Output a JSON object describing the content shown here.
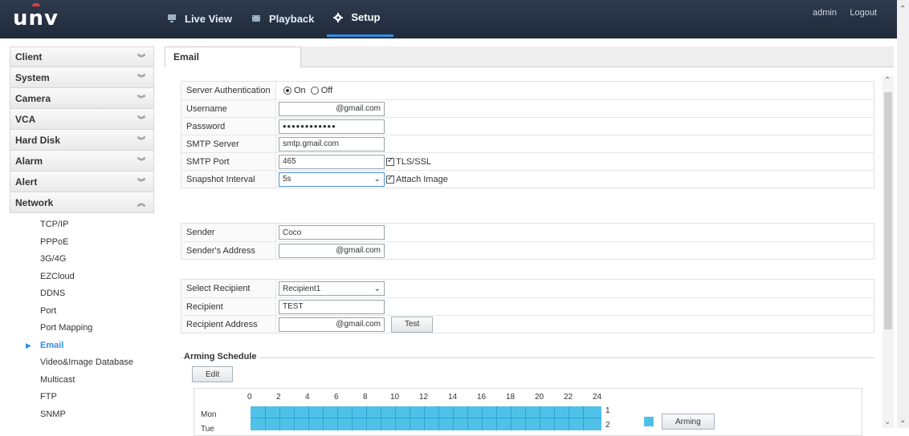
{
  "header": {
    "logo": "unv",
    "nav": [
      {
        "label": "Live View",
        "icon": "monitor-icon"
      },
      {
        "label": "Playback",
        "icon": "film-icon"
      },
      {
        "label": "Setup",
        "icon": "gear-icon"
      }
    ],
    "user": "admin",
    "logout": "Logout"
  },
  "sidebar": {
    "menus": [
      "Client",
      "System",
      "Camera",
      "VCA",
      "Hard Disk",
      "Alarm",
      "Alert",
      "Network"
    ],
    "submenu": [
      "TCP/IP",
      "PPPoE",
      "3G/4G",
      "EZCloud",
      "DDNS",
      "Port",
      "Port Mapping",
      "Email",
      "Video&Image Database",
      "Multicast",
      "FTP",
      "SNMP"
    ],
    "active_sub": "Email"
  },
  "tab": {
    "label": "Email"
  },
  "server": {
    "auth_label": "Server Authentication",
    "on_label": "On",
    "off_label": "Off",
    "username_label": "Username",
    "username_value": "@gmail.com",
    "password_label": "Password",
    "password_value": "••••••••••••",
    "smtp_server_label": "SMTP Server",
    "smtp_server_value": "smtp.gmail.com",
    "smtp_port_label": "SMTP Port",
    "smtp_port_value": "465",
    "tls_label": "TLS/SSL",
    "snapshot_label": "Snapshot Interval",
    "snapshot_value": "5s",
    "attach_label": "Attach Image"
  },
  "sender": {
    "sender_label": "Sender",
    "sender_value": "Coco",
    "address_label": "Sender's Address",
    "address_value": "@gmail.com"
  },
  "recipient": {
    "select_label": "Select Recipient",
    "select_value": "Recipient1",
    "recipient_label": "Recipient",
    "recipient_value": "TEST",
    "address_label": "Recipient Address",
    "address_value": "@gmail.com",
    "test_button": "Test"
  },
  "schedule": {
    "title": "Arming Schedule",
    "edit_button": "Edit",
    "hours": [
      "0",
      "2",
      "4",
      "6",
      "8",
      "10",
      "12",
      "14",
      "16",
      "18",
      "20",
      "22",
      "24"
    ],
    "days": [
      "Mon",
      "Tue"
    ],
    "day_numbers": [
      "1",
      "2"
    ],
    "legend_button": "Arming",
    "arming_color": "#4fc1e9"
  }
}
